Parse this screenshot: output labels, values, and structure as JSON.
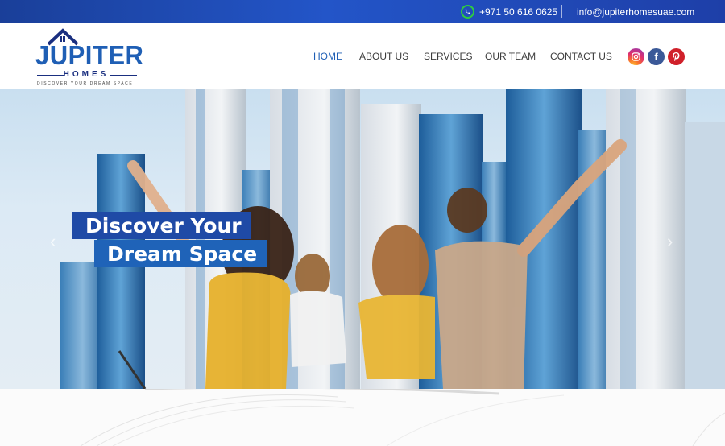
{
  "topbar": {
    "phone": "+971 50 616 0625",
    "email": "info@jupiterhomesuae.com",
    "phone_icon": "whatsapp-icon"
  },
  "logo": {
    "brand": "JUPITER",
    "sub": "HOMES",
    "tagline": "DISCOVER YOUR DREAM SPACE"
  },
  "nav": {
    "items": [
      {
        "label": "HOME",
        "active": true
      },
      {
        "label": "ABOUT US"
      },
      {
        "label": "SERVICES"
      },
      {
        "label": "OUR TEAM"
      },
      {
        "label": "CONTACT US"
      }
    ]
  },
  "social": {
    "instagram": "instagram-icon",
    "facebook": "facebook-icon",
    "pinterest": "pinterest-icon"
  },
  "hero": {
    "line1": "Discover Your",
    "line2": "Dream Space",
    "prev_arrow": "‹",
    "next_arrow": "›"
  },
  "colors": {
    "brand_blue": "#1f5fb5",
    "topbar": "#2355c8",
    "headline_bg": "#1f4aa6"
  }
}
